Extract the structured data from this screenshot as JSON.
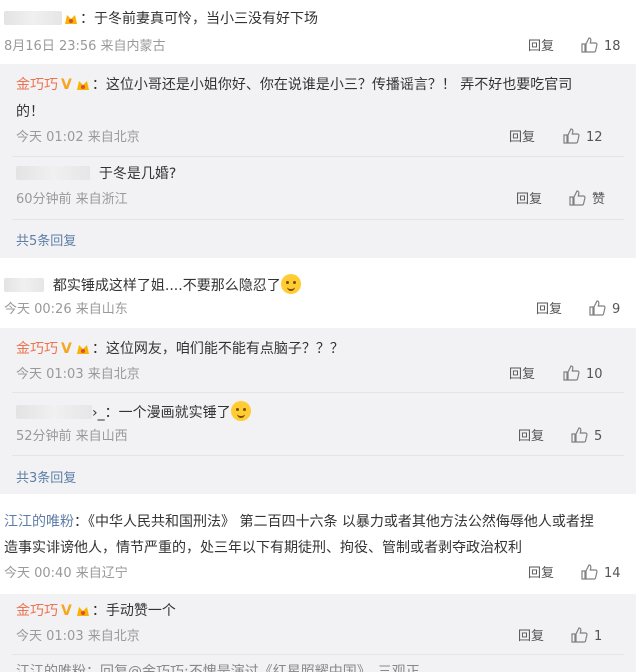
{
  "c1": {
    "text": "：于冬前妻真可怜，当小三没有好下场",
    "meta": "8月16日 23:56 来自内蒙古",
    "reply_label": "回复",
    "likes": "18"
  },
  "c1r1": {
    "user": "金巧巧",
    "text_line1": "：这位小哥还是小姐你好、你在说谁是小三？传播谣言？！ 弄不好也要吃官司",
    "text_line2": "的！",
    "meta": "今天 01:02 来自北京",
    "reply_label": "回复",
    "likes": "12"
  },
  "c1r2": {
    "text": "于冬是几婚?",
    "meta": "60分钟前 来自浙江",
    "reply_label": "回复",
    "likes": "赞"
  },
  "c1_more": "共5条回复",
  "c2": {
    "text": "都实锤成这样了姐....不要那么隐忍了",
    "meta": "今天 00:26 来自山东",
    "reply_label": "回复",
    "likes": "9"
  },
  "c2r1": {
    "user": "金巧巧",
    "text": "：这位网友，咱们能不能有点脑子？？？",
    "meta": "今天 01:03 来自北京",
    "reply_label": "回复",
    "likes": "10"
  },
  "c2r2": {
    "text": "›_：一个漫画就实锤了",
    "meta": "52分钟前 来自山西",
    "reply_label": "回复",
    "likes": "5"
  },
  "c2_more": "共3条回复",
  "c3": {
    "user": "江江的唯粉",
    "text_line1": "：《中华人民共和国刑法》 第二百四十六条 以暴力或者其他方法公然侮辱他人或者捏",
    "text_line2": "造事实诽谤他人，情节严重的，处三年以下有期徒刑、拘役、管制或者剥夺政治权利",
    "meta": "今天 00:40 来自辽宁",
    "reply_label": "回复",
    "likes": "14"
  },
  "c3r1": {
    "user": "金巧巧",
    "text": "：手动赞一个",
    "meta": "今天 01:03 来自北京",
    "reply_label": "回复",
    "likes": "1"
  },
  "c3r2_partial": "江江的唯粉：回复@金巧巧:不愧是演过《红星照耀中国》，三观正"
}
